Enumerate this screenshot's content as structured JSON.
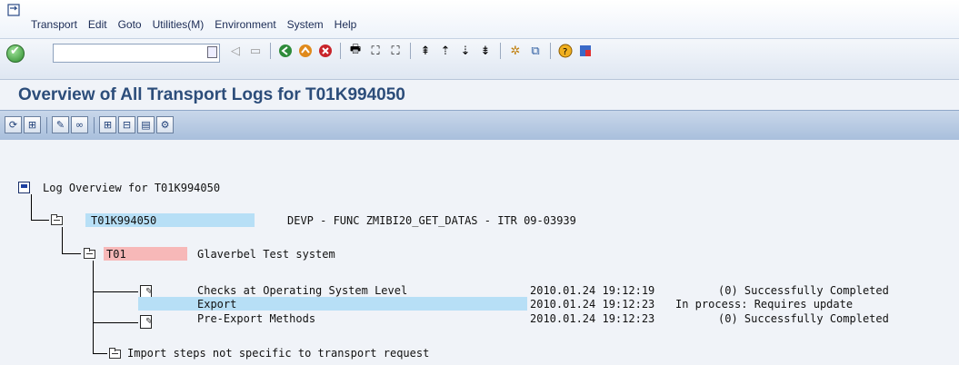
{
  "menu": {
    "items": [
      "Transport",
      "Edit",
      "Goto",
      "Utilities(M)",
      "Environment",
      "System",
      "Help"
    ]
  },
  "toolbar": {
    "command_field_value": "",
    "icons": [
      "enter-icon",
      "back-icon",
      "exit-icon",
      "cancel-icon",
      "print-icon",
      "find-icon",
      "find-next-icon",
      "first-page-icon",
      "previous-page-icon",
      "next-page-icon",
      "last-page-icon",
      "new-session-icon",
      "shortcut-icon",
      "help-icon",
      "customize-icon"
    ]
  },
  "title": "Overview of All Transport Logs for T01K994050",
  "app_toolbar": {
    "icons": [
      "refresh-icon",
      "expand-all-icon",
      "display-log-icon",
      "choose-icon",
      "expand-subtree-icon",
      "collapse-subtree-icon",
      "legend-icon",
      "settings-icon"
    ]
  },
  "tree": {
    "root_label": "Log Overview for T01K994050",
    "request": {
      "id": "T01K994050",
      "description": "DEVP - FUNC ZMIBI20_GET_DATAS - ITR 09-03939"
    },
    "system": {
      "id": "T01",
      "name": "Glaverbel Test system"
    },
    "steps": [
      {
        "name": "Checks at Operating System Level",
        "datetime": "2010.01.24 19:12:19",
        "status": "(0) Successfully Completed"
      },
      {
        "name": "Export",
        "datetime": "2010.01.24 19:12:23",
        "status": "In process: Requires update"
      },
      {
        "name": "Pre-Export Methods",
        "datetime": "2010.01.24 19:12:23",
        "status": "(0) Successfully Completed"
      }
    ],
    "import_label": "Import steps not specific to transport request"
  },
  "colors": {
    "title": "#2c4d7a",
    "highlight_blue": "#b7dff6",
    "highlight_red": "#f7b8b8",
    "app_toolbar": "#b9cbe3"
  }
}
